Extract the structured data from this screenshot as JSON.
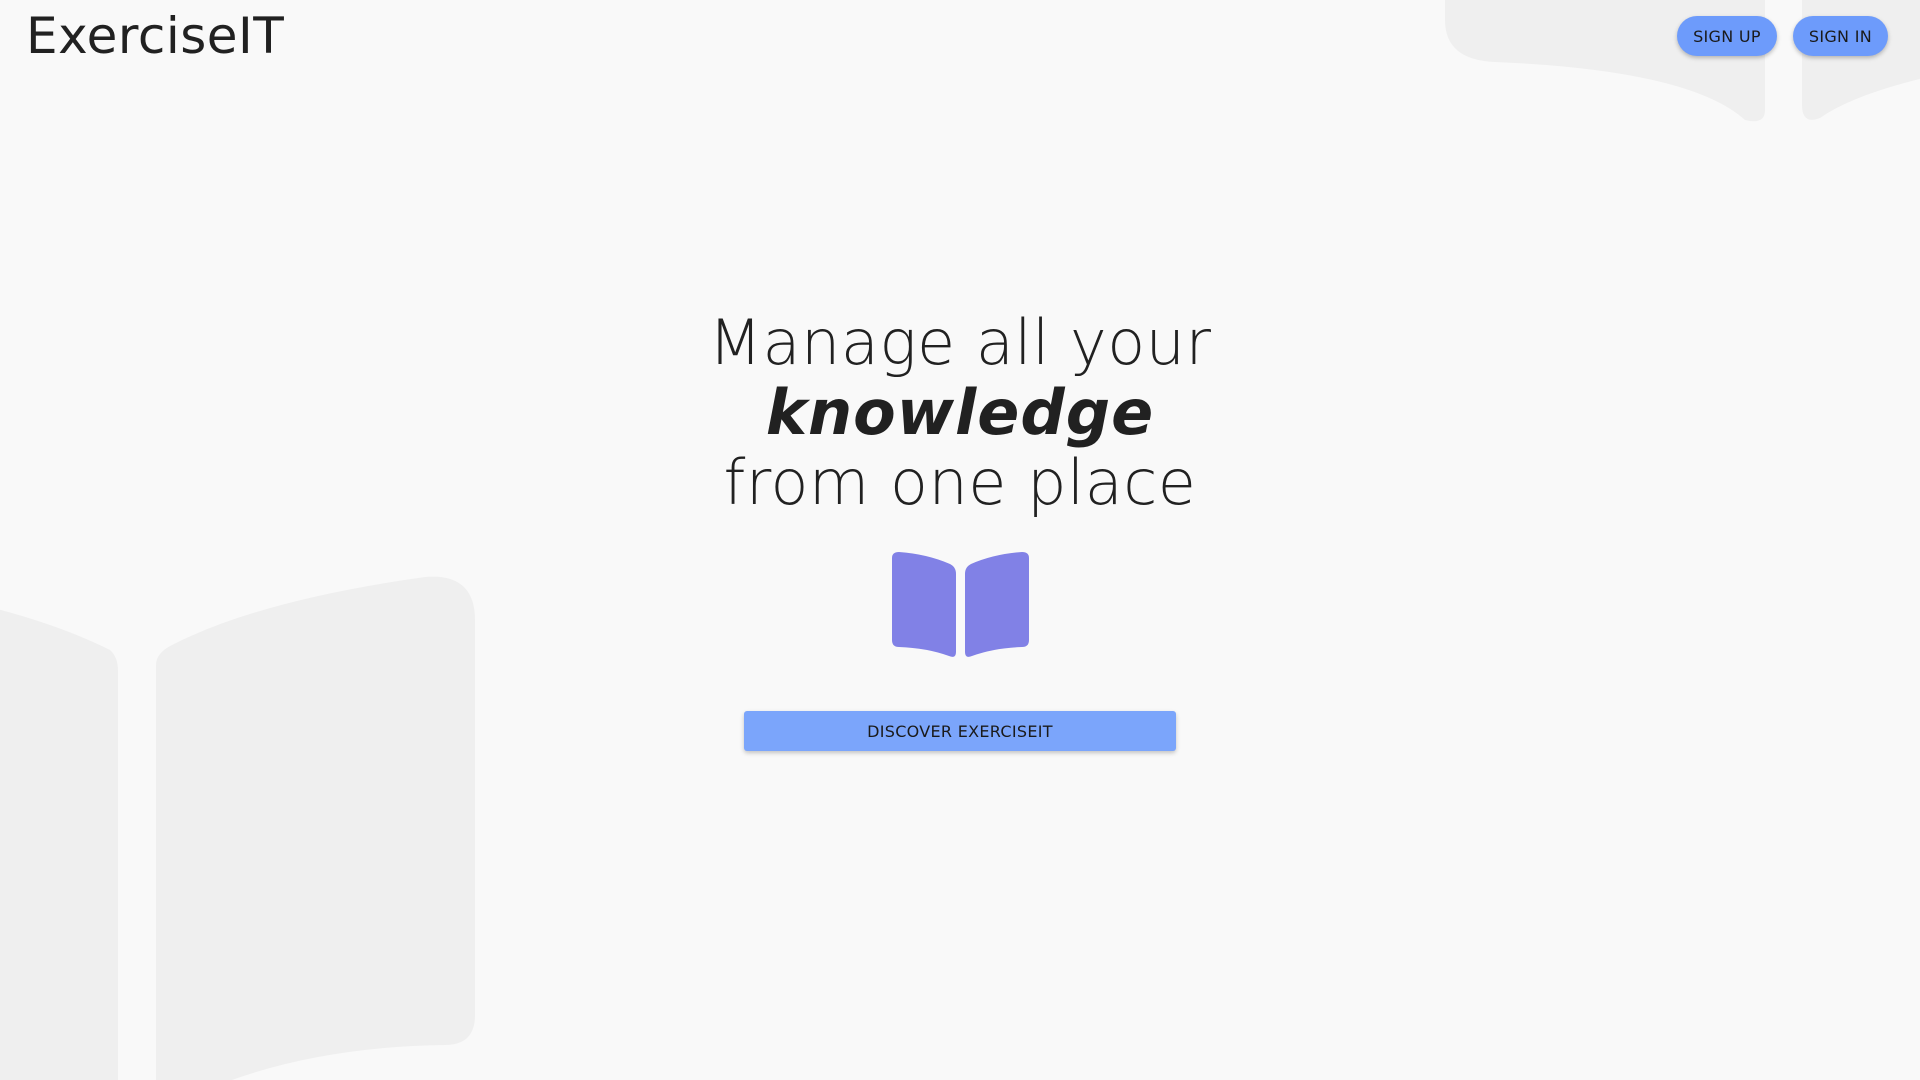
{
  "header": {
    "logo_text": "ExerciseIT",
    "sign_up_label": "SIGN UP",
    "sign_in_label": "SIGN IN"
  },
  "hero": {
    "line1": "Manage all your",
    "line2": "knowledge",
    "line3": "from one place",
    "icon": "open-book-icon",
    "cta_label": "DISCOVER EXERCISEIT"
  },
  "colors": {
    "background": "#f9f9f9",
    "button_primary": "#6d9bfb",
    "cta_button": "#7ba5fb",
    "book_icon": "#8181e6",
    "background_book": "#efefef",
    "text": "#212121"
  }
}
